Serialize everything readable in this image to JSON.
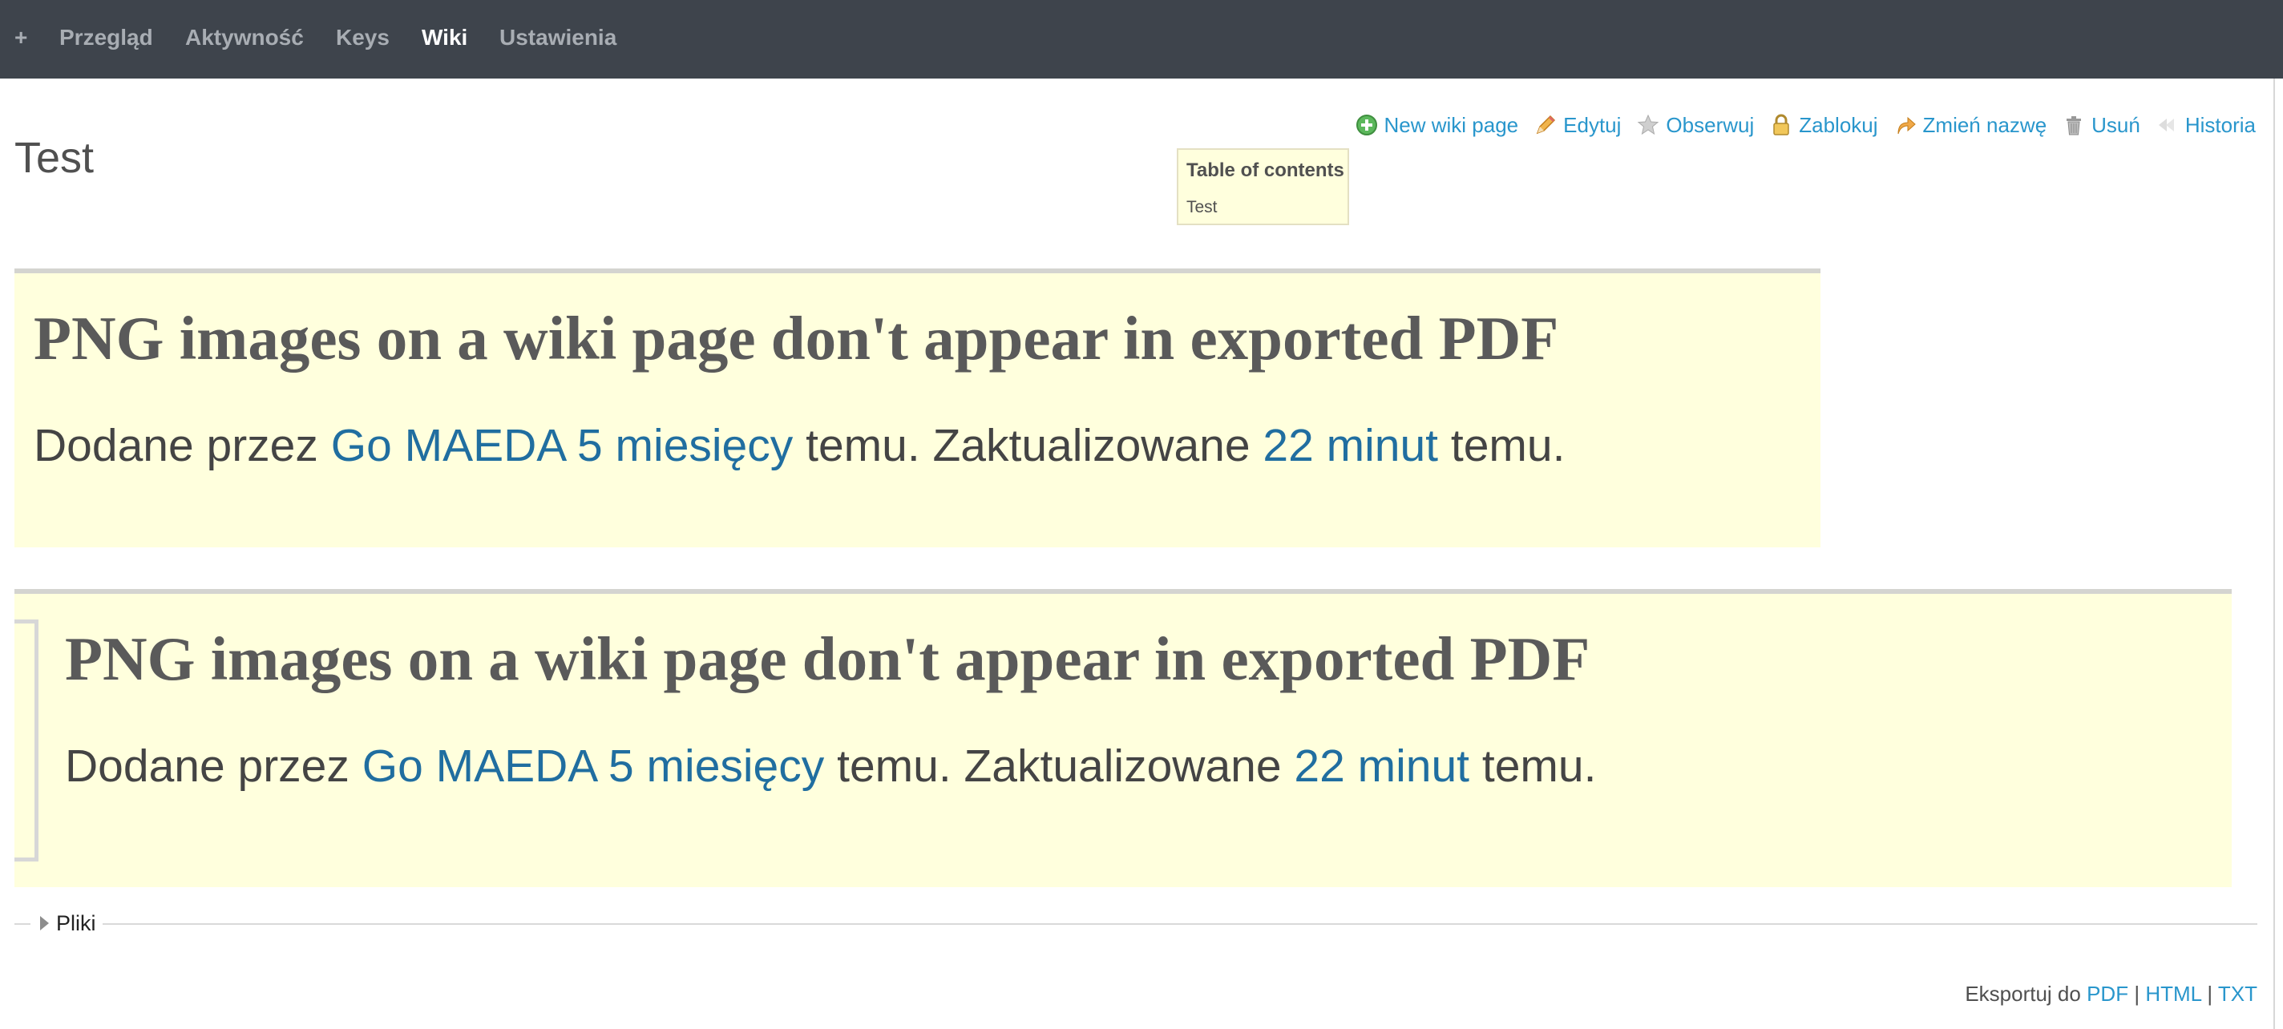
{
  "nav": {
    "items": [
      {
        "label": "+"
      },
      {
        "label": "Przegląd"
      },
      {
        "label": "Aktywność"
      },
      {
        "label": "Keys"
      },
      {
        "label": "Wiki"
      },
      {
        "label": "Ustawienia"
      }
    ],
    "selected": "Wiki"
  },
  "page": {
    "title": "Test"
  },
  "actions": [
    {
      "label": "New wiki page",
      "icon": "add-icon"
    },
    {
      "label": "Edytuj",
      "icon": "pencil-icon"
    },
    {
      "label": "Obserwuj",
      "icon": "star-icon"
    },
    {
      "label": "Zablokuj",
      "icon": "lock-icon"
    },
    {
      "label": "Zmień nazwę",
      "icon": "rename-arrow-icon"
    },
    {
      "label": "Usuń",
      "icon": "trash-icon"
    },
    {
      "label": "Historia",
      "icon": "history-icon"
    }
  ],
  "toc": {
    "title": "Table of contents",
    "items": [
      "Test"
    ]
  },
  "screenshot1": {
    "heading": "PNG images on a wiki page don't appear in exported PDF",
    "meta_prefix": "Dodane przez ",
    "author": "Go MAEDA",
    "created": "5 miesięcy",
    "meta_mid": " temu. Zaktualizowane ",
    "updated": "22 minut",
    "meta_suffix": " temu."
  },
  "screenshot2": {
    "heading": "PNG images on a wiki page don't appear in exported PDF",
    "meta_prefix": "Dodane przez ",
    "author": "Go MAEDA",
    "created": "5 miesięcy",
    "meta_mid": " temu. Zaktualizowane ",
    "updated": "22 minut",
    "meta_suffix": " temu."
  },
  "files": {
    "label": "Pliki"
  },
  "export": {
    "prefix": "Eksportuj do",
    "formats": [
      "PDF",
      "HTML",
      "TXT"
    ],
    "separator": "|"
  },
  "colors": {
    "nav_bg": "#3e444c",
    "link": "#2996cc",
    "highlight_bg": "#ffffdd"
  }
}
